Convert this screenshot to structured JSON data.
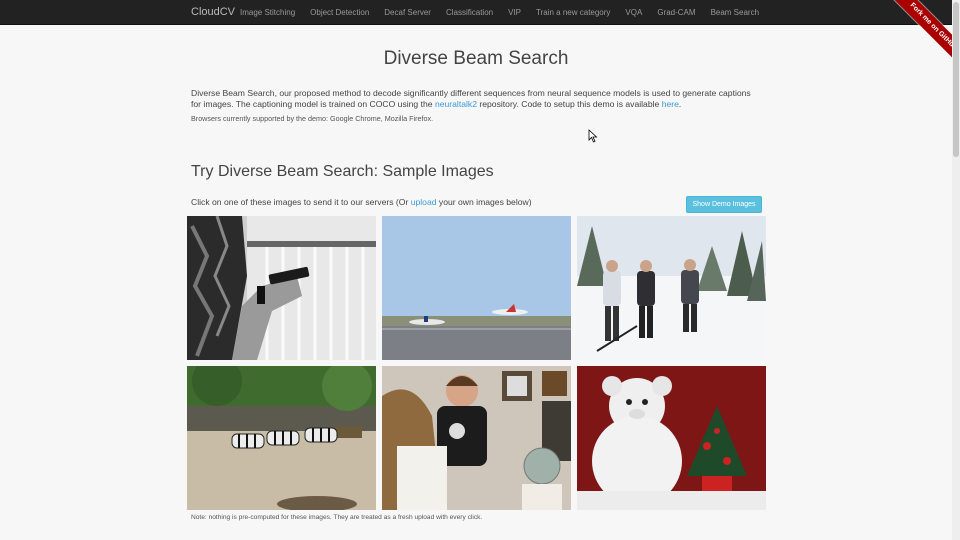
{
  "navbar": {
    "brand": "CloudCV",
    "links": [
      "Image Stitching",
      "Object Detection",
      "Decaf Server",
      "Classification",
      "VIP",
      "Train a new category",
      "VQA",
      "Grad-CAM",
      "Beam Search"
    ]
  },
  "ribbon": {
    "label": "Fork me on GitHub"
  },
  "page": {
    "title": "Diverse Beam Search",
    "intro_text_1": "Diverse Beam Search, our proposed method to decode significantly different sequences from neural sequence models is used to generate captions for images. The captioning model is trained on COCO using the ",
    "intro_link_1": "neuraltalk2",
    "intro_text_2": " repository. Code to setup this demo is available ",
    "intro_link_2": "here",
    "intro_text_3": ".",
    "browsers": "Browsers currently supported by the demo: Google Chrome, Mozilla Firefox."
  },
  "samples": {
    "title": "Try Diverse Beam Search: Sample Images",
    "instruction_1": "Click on one of these images to send it to our servers (Or ",
    "instruction_link": "upload",
    "instruction_2": " your own images below)",
    "show_button": "Show Demo Images",
    "note": "Note: nothing is pre-computed for these images. They are treated as a fresh upload with every click."
  }
}
